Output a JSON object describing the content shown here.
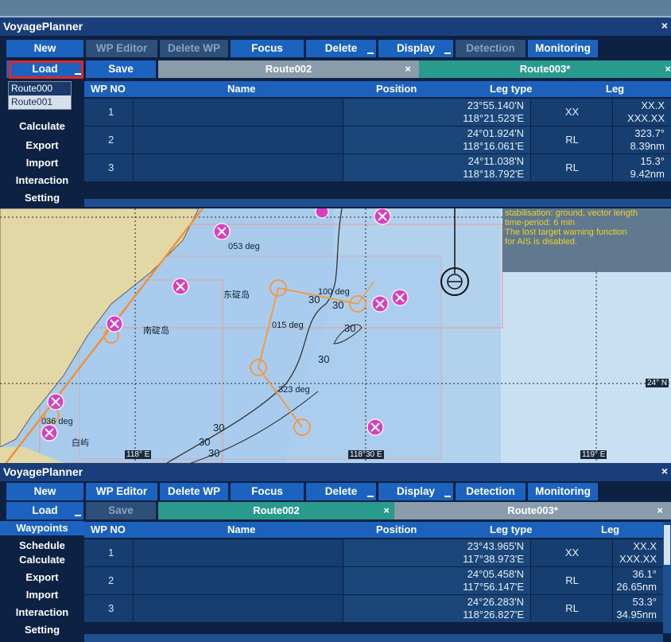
{
  "top_panel": {
    "title": "VoyagePlanner",
    "close": "×",
    "toolbar": [
      "New",
      "WP Editor",
      "Delete WP",
      "Focus",
      "Delete",
      "Display",
      "Detection",
      "Monitoring"
    ],
    "load_label": "Load",
    "save_label": "Save",
    "tabs": [
      {
        "label": "Route002",
        "close": "×"
      },
      {
        "label": "Route003*",
        "close": "×"
      }
    ],
    "dropdown_items": [
      "Route000",
      "Route001"
    ],
    "sidebar": [
      "Calculate",
      "Export",
      "Import",
      "Interaction",
      "Setting"
    ],
    "columns": [
      "WP NO",
      "Name",
      "Position",
      "Leg type",
      "Leg"
    ],
    "rows": [
      {
        "no": "1",
        "lat": "23°55.140'N",
        "lon": "118°21.523'E",
        "leg_type": "XX",
        "course": "XX.X",
        "dist": "XXX.XX"
      },
      {
        "no": "2",
        "lat": "24°01.924'N",
        "lon": "118°16.061'E",
        "leg_type": "RL",
        "course": "323.7°",
        "dist": "8.39nm"
      },
      {
        "no": "3",
        "lat": "24°11.038'N",
        "lon": "118°18.792'E",
        "leg_type": "RL",
        "course": "15.3°",
        "dist": "9.42nm"
      }
    ]
  },
  "map": {
    "info_lines": [
      "stabilisation: ground, vector length",
      "time-period: 6 min",
      "The lost target warning function",
      "for AIS is disabled."
    ],
    "labels": {
      "deg053": "053 deg",
      "deg100": "100 deg",
      "deg015": "015 deg",
      "deg323": "323 deg",
      "deg036": "036 deg",
      "isl1": "东碇岛",
      "isl2": "南碇岛",
      "isl3": "白屿",
      "d30a": "30",
      "d30b": "30",
      "d30c": "30",
      "d30d": "30",
      "d30e": "30",
      "d30f": "30",
      "d30g": "30"
    },
    "lon_labels": [
      "118° E",
      "118°30 E",
      "119° E"
    ],
    "lat_label": "24° N"
  },
  "bottom_panel": {
    "title": "VoyagePlanner",
    "close": "×",
    "toolbar": [
      "New",
      "WP Editor",
      "Delete WP",
      "Focus",
      "Delete",
      "Display",
      "Detection",
      "Monitoring"
    ],
    "load_label": "Load",
    "save_label": "Save",
    "tabs": [
      {
        "label": "Route002",
        "close": "×"
      },
      {
        "label": "Route003*",
        "close": "×"
      }
    ],
    "sidebar": [
      "Waypoints",
      "Schedule",
      "Calculate",
      "Export",
      "Import",
      "Interaction",
      "Setting"
    ],
    "columns": [
      "WP NO",
      "Name",
      "Position",
      "Leg type",
      "Leg"
    ],
    "rows": [
      {
        "no": "1",
        "lat": "23°43.965'N",
        "lon": "117°38.973'E",
        "leg_type": "XX",
        "course": "XX.X",
        "dist": "XXX.XX"
      },
      {
        "no": "2",
        "lat": "24°05.458'N",
        "lon": "117°56.147'E",
        "leg_type": "RL",
        "course": "36.1°",
        "dist": "26.65nm"
      },
      {
        "no": "3",
        "lat": "24°26.283'N",
        "lon": "118°26.827'E",
        "leg_type": "RL",
        "course": "53.3°",
        "dist": "34.95nm"
      }
    ]
  },
  "colors": {
    "accent": "#1c63c0",
    "active_tab": "#2a9a8e",
    "header": "#1a3e79",
    "highlight": "#e0262a"
  }
}
